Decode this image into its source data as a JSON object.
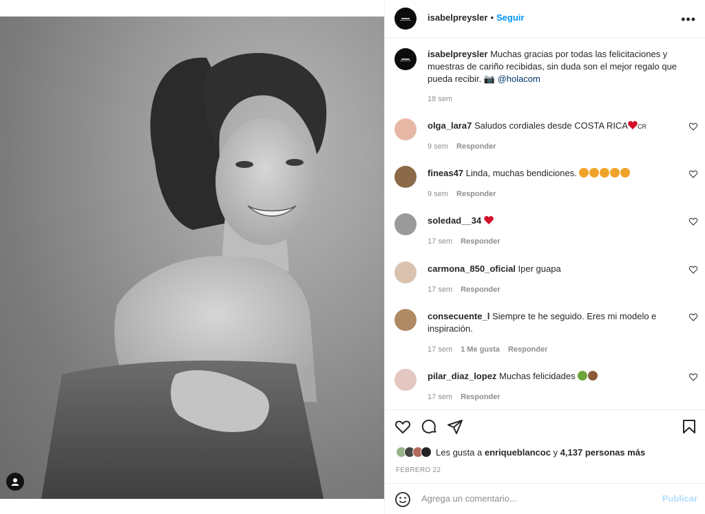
{
  "post": {
    "username": "isabelpreysler",
    "follow_label": "Seguir",
    "more_label": "•••"
  },
  "caption": {
    "username": "isabelpreysler",
    "text": "Muchas gracias por todas las felicitaciones y muestras de cariño recibidas, sin duda son el mejor regalo que pueda recibir. 📷",
    "mention": "@holacom",
    "time": "18 sem"
  },
  "comments": [
    {
      "username": "olga_lara7",
      "text": "Saludos cordiales desde COSTA RICA",
      "suffix": "CR",
      "time": "9 sem",
      "reply": "Responder",
      "avatar_color": "#e7b7a6"
    },
    {
      "username": "fineas47",
      "text": "Linda, muchas bendiciones.",
      "time": "9 sem",
      "reply": "Responder",
      "avatar_color": "#8a6a48"
    },
    {
      "username": "soledad__34",
      "text": "",
      "time": "17 sem",
      "reply": "Responder",
      "avatar_color": "#9a9a9a"
    },
    {
      "username": "carmona_850_oficial",
      "text": "Iper guapa",
      "time": "17 sem",
      "reply": "Responder",
      "avatar_color": "#d9c3b0"
    },
    {
      "username": "consecuente_l",
      "text": "Siempre te he seguido. Eres mi modelo e inspiración.",
      "time": "17 sem",
      "likes": "1 Me gusta",
      "reply": "Responder",
      "avatar_color": "#b08a64"
    },
    {
      "username": "pilar_diaz_lopez",
      "text": "Muchas felicidades",
      "time": "17 sem",
      "reply": "Responder",
      "avatar_color": "#e4c7c0"
    }
  ],
  "likes": {
    "prefix": "Les gusta a",
    "user": "enriqueblancoc",
    "middle": "y",
    "count": "4,137 personas más"
  },
  "date": "FEBRERO 22",
  "add_comment": {
    "placeholder": "Agrega un comentario...",
    "publish": "Publicar"
  },
  "colors": {
    "accent": "#0095f6",
    "link": "#00376b",
    "muted": "#8e8e8e",
    "heart_red": "#ed1c24"
  }
}
